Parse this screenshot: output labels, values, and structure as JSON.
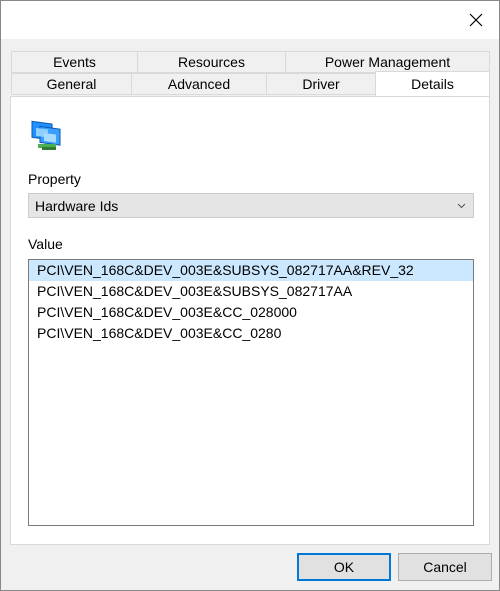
{
  "dialog": {
    "close_icon": "close-icon",
    "tabs_row1": [
      "Events",
      "Resources",
      "Power Management"
    ],
    "tabs_row2": [
      "General",
      "Advanced",
      "Driver",
      "Details"
    ],
    "active_tab": "Details"
  },
  "details": {
    "device_icon": "network-adapter-icon",
    "property_label": "Property",
    "property_value": "Hardware Ids",
    "value_label": "Value",
    "values": [
      "PCI\\VEN_168C&DEV_003E&SUBSYS_082717AA&REV_32",
      "PCI\\VEN_168C&DEV_003E&SUBSYS_082717AA",
      "PCI\\VEN_168C&DEV_003E&CC_028000",
      "PCI\\VEN_168C&DEV_003E&CC_0280"
    ],
    "selected_index": 0
  },
  "buttons": {
    "ok": "OK",
    "cancel": "Cancel"
  },
  "colors": {
    "accent": "#0078d7",
    "selection": "#cce8ff"
  }
}
